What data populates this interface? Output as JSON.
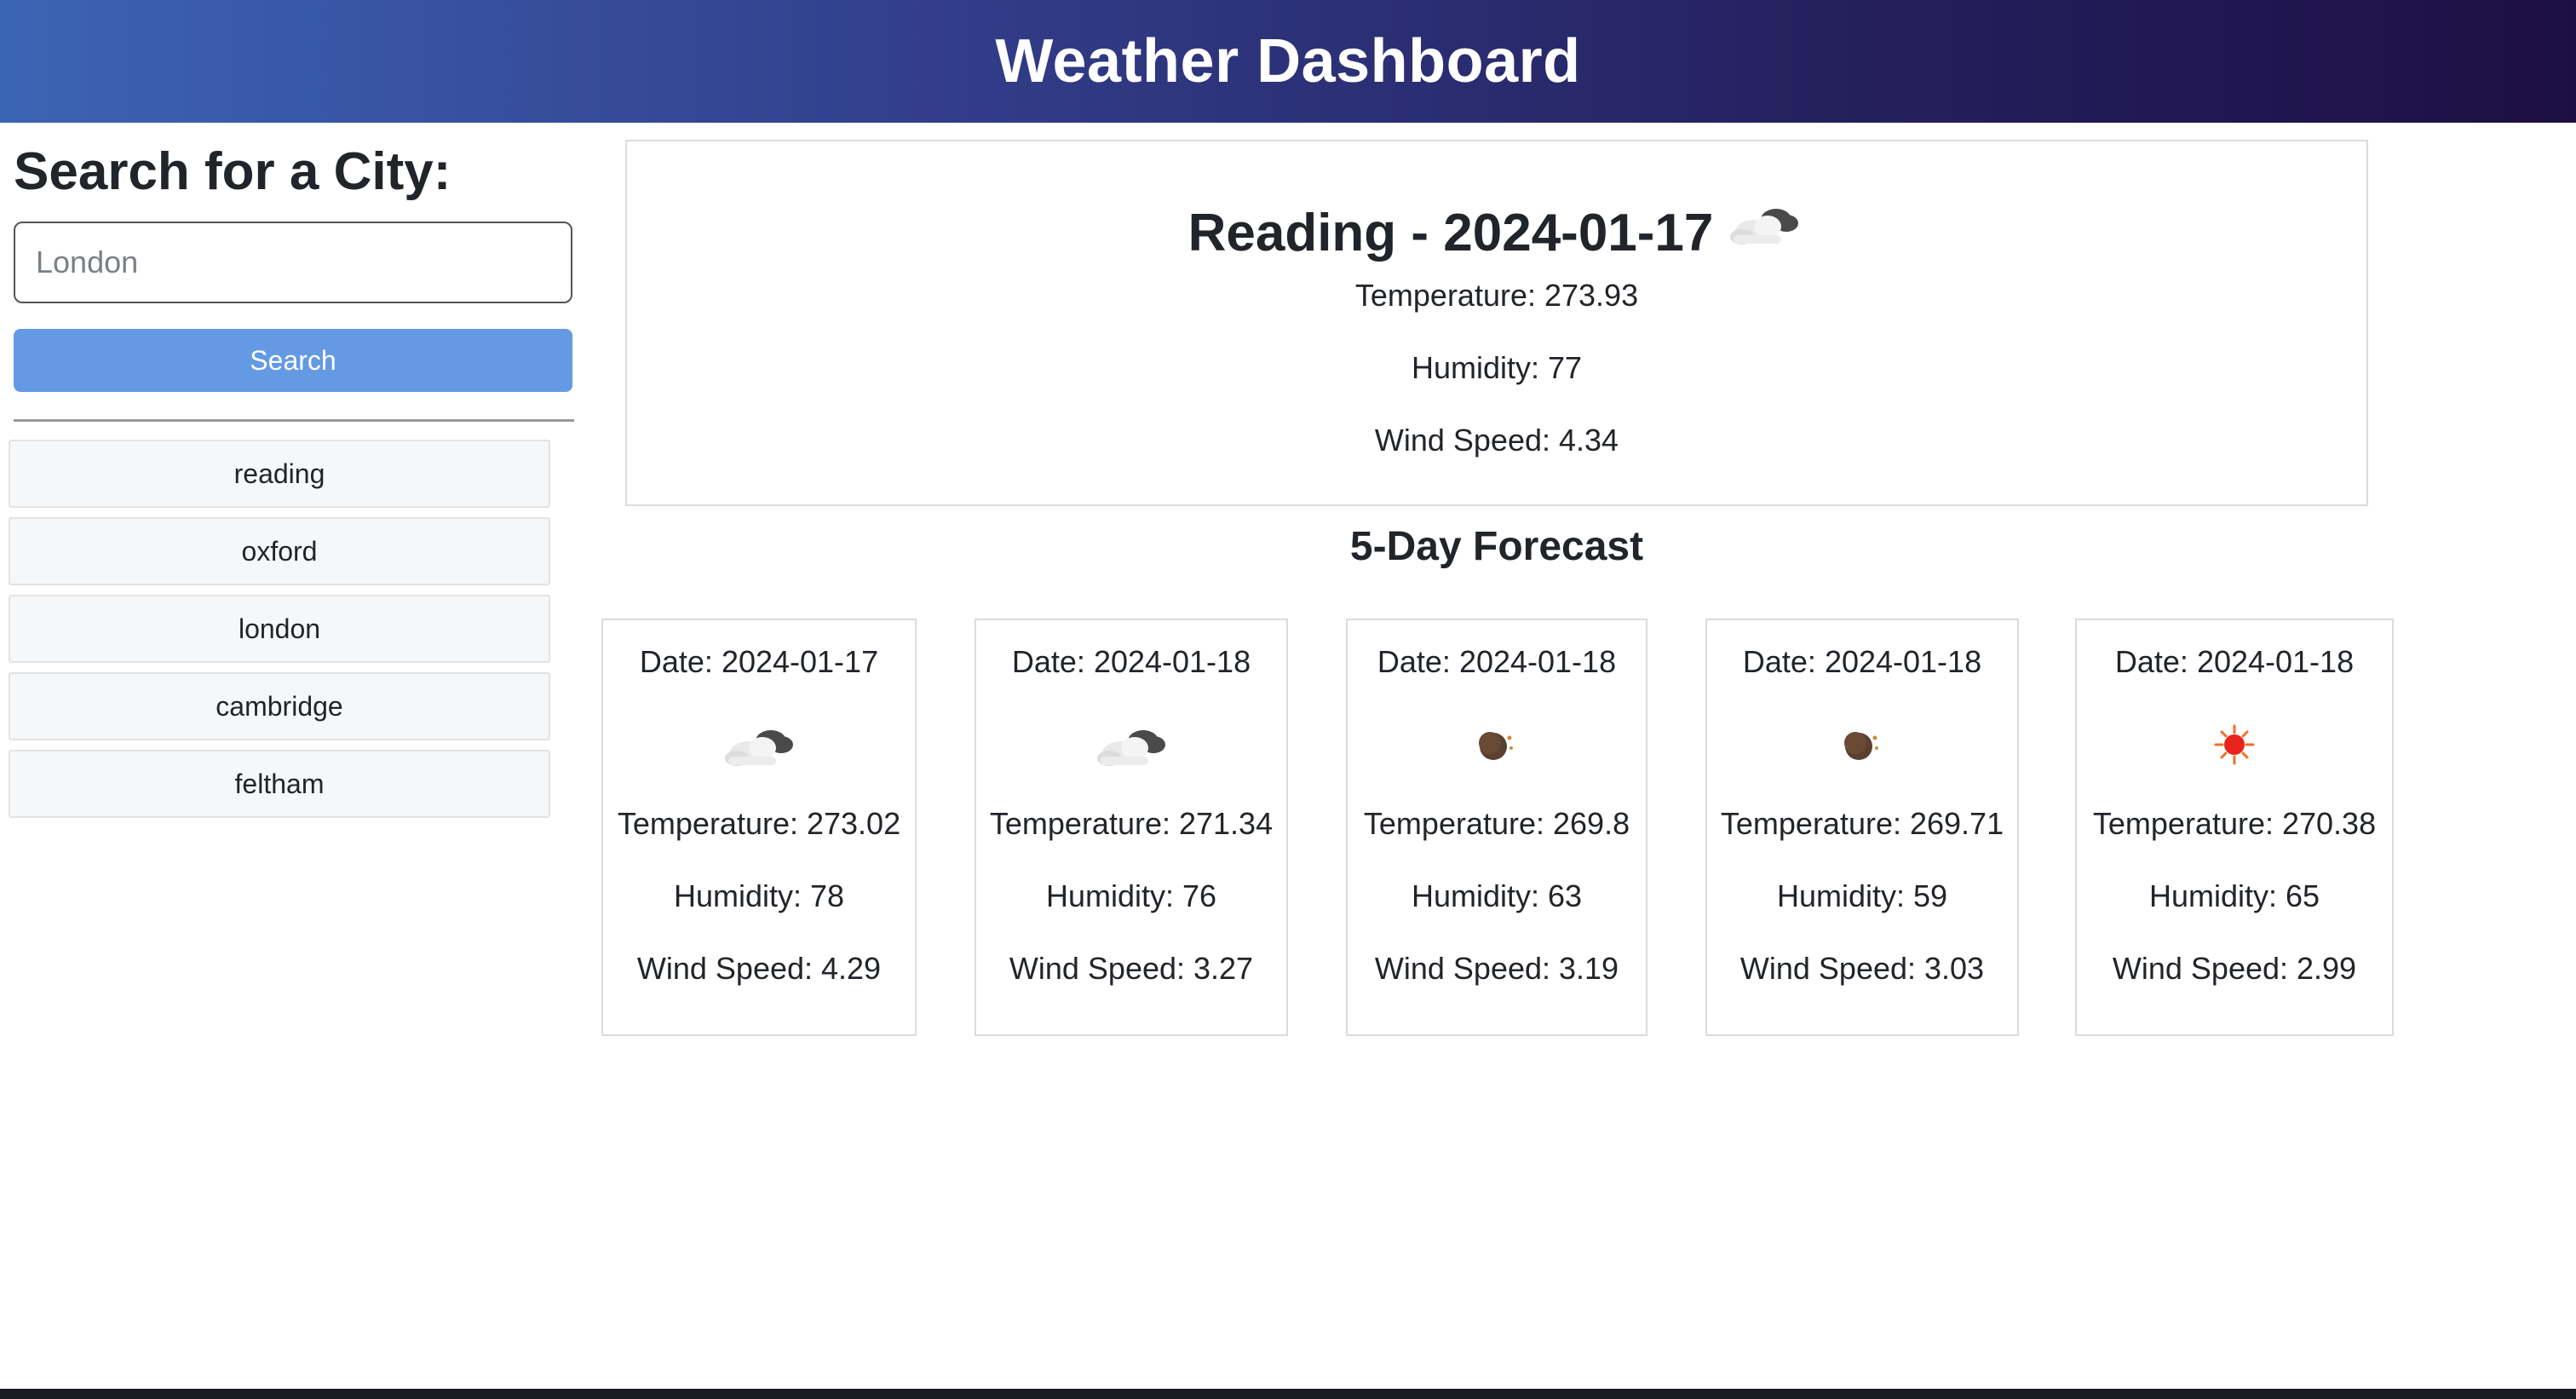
{
  "header": {
    "title": "Weather Dashboard"
  },
  "sidebar": {
    "heading": "Search for a City:",
    "search_placeholder": "London",
    "search_button": "Search",
    "history": [
      "reading",
      "oxford",
      "london",
      "cambridge",
      "feltham"
    ]
  },
  "current": {
    "title": "Reading - 2024-01-17",
    "icon": "cloudy-icon",
    "temperature": "Temperature: 273.93",
    "humidity": "Humidity: 77",
    "wind": "Wind Speed: 4.34"
  },
  "forecast": {
    "heading": "5-Day Forecast",
    "days": [
      {
        "date": "Date: 2024-01-17",
        "icon": "cloudy-icon",
        "temperature": "Temperature: 273.02",
        "humidity": "Humidity: 78",
        "wind": "Wind Speed: 4.29"
      },
      {
        "date": "Date: 2024-01-18",
        "icon": "cloudy-icon",
        "temperature": "Temperature: 271.34",
        "humidity": "Humidity: 76",
        "wind": "Wind Speed: 3.27"
      },
      {
        "date": "Date: 2024-01-18",
        "icon": "moon-icon",
        "temperature": "Temperature: 269.8",
        "humidity": "Humidity: 63",
        "wind": "Wind Speed: 3.19"
      },
      {
        "date": "Date: 2024-01-18",
        "icon": "moon-icon",
        "temperature": "Temperature: 269.71",
        "humidity": "Humidity: 59",
        "wind": "Wind Speed: 3.03"
      },
      {
        "date": "Date: 2024-01-18",
        "icon": "sun-icon",
        "temperature": "Temperature: 270.38",
        "humidity": "Humidity: 65",
        "wind": "Wind Speed: 2.99"
      }
    ]
  },
  "colors": {
    "header_gradient_start": "#3c64b4",
    "header_gradient_end": "#1d0f45",
    "search_button": "#6499e3"
  }
}
